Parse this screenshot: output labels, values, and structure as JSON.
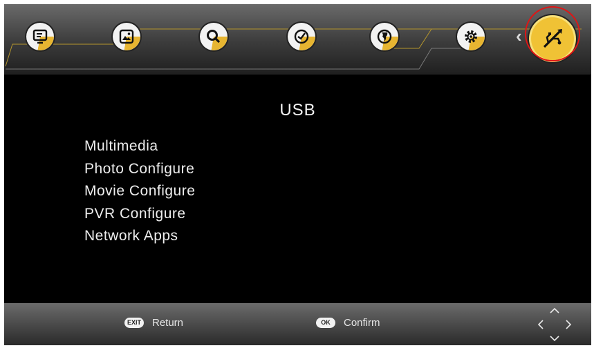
{
  "top_menu": {
    "items": [
      {
        "icon": "tv-icon"
      },
      {
        "icon": "picture-icon"
      },
      {
        "icon": "search-icon"
      },
      {
        "icon": "clock-icon"
      },
      {
        "icon": "globe-icon"
      },
      {
        "icon": "gear-icon"
      },
      {
        "icon": "usb-icon",
        "active": true
      }
    ],
    "chevron": "‹"
  },
  "page": {
    "title": "USB",
    "items": [
      "Multimedia",
      "Photo Configure",
      "Movie Configure",
      "PVR Configure",
      "Network Apps"
    ]
  },
  "footer": {
    "return": {
      "key": "EXIT",
      "label": "Return"
    },
    "confirm": {
      "key": "OK",
      "label": "Confirm"
    },
    "nav_icon": "dpad-arrows-icon"
  },
  "colors": {
    "accent": "#f0c235",
    "highlight_ring": "#e01515",
    "background": "#000000"
  }
}
